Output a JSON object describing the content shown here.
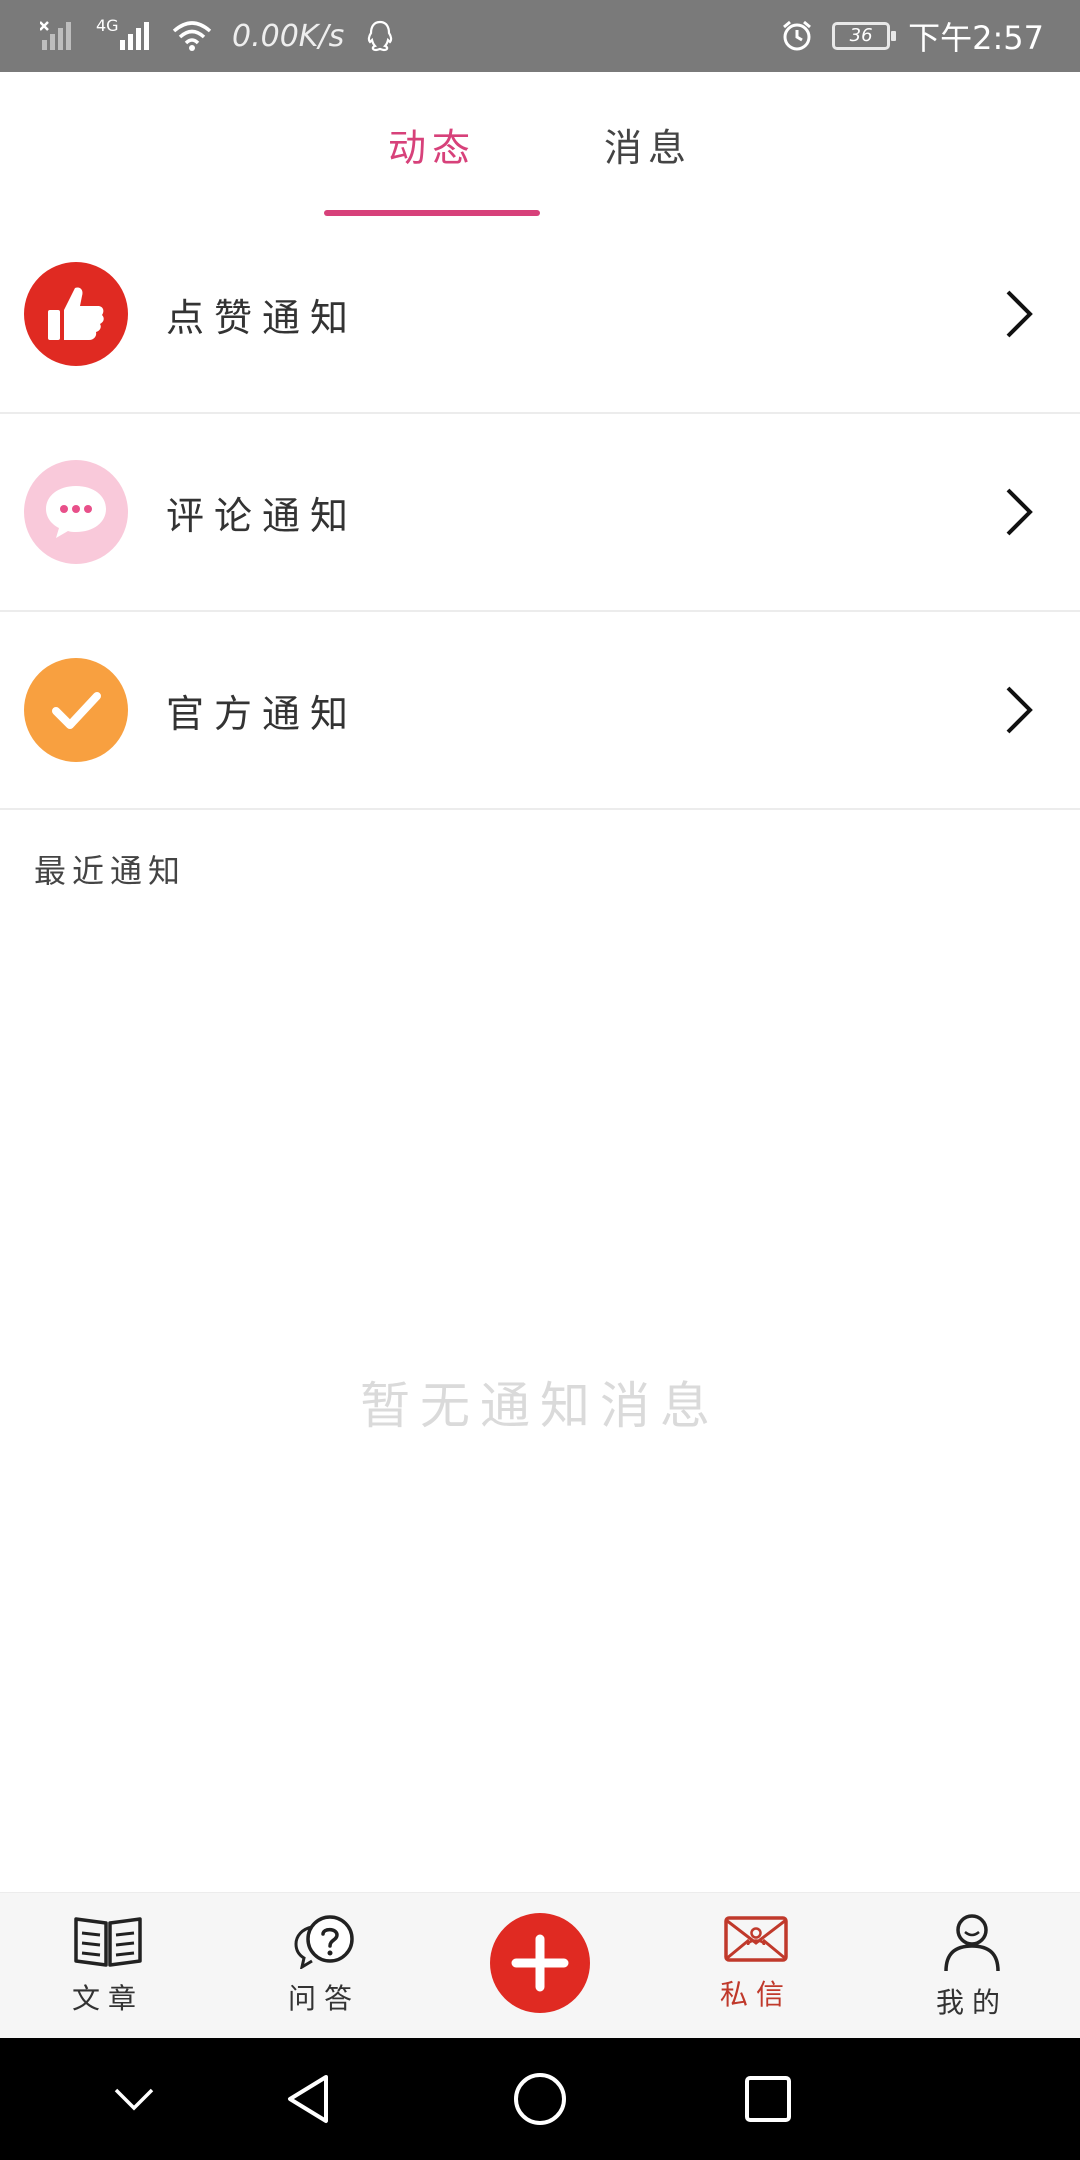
{
  "status_bar": {
    "network_speed": "0.00K/s",
    "network_type": "4G",
    "battery_level": "36",
    "time": "下午2:57",
    "icons": [
      "signal-icon",
      "wifi-icon",
      "qq-icon",
      "alarm-icon",
      "battery-icon"
    ]
  },
  "tabs": [
    {
      "label": "动态",
      "active": true
    },
    {
      "label": "消息",
      "active": false
    }
  ],
  "notifications": [
    {
      "label": "点赞通知",
      "icon": "thumbs-up-icon",
      "color": "#e02a22"
    },
    {
      "label": "评论通知",
      "icon": "comment-icon",
      "color": "#f9c2d6"
    },
    {
      "label": "官方通知",
      "icon": "checkmark-icon",
      "color": "#f8a040"
    }
  ],
  "recent_section": {
    "title": "最近通知"
  },
  "empty_state": {
    "text": "暂无通知消息"
  },
  "bottom_nav": [
    {
      "label": "文章",
      "icon": "book-icon",
      "active": false
    },
    {
      "label": "问答",
      "icon": "question-icon",
      "active": false
    },
    {
      "label": "",
      "icon": "add-icon",
      "active": false
    },
    {
      "label": "私信",
      "icon": "mail-icon",
      "active": true
    },
    {
      "label": "我的",
      "icon": "profile-icon",
      "active": false
    }
  ],
  "colors": {
    "accent": "#d7417a",
    "brand_red": "#e02a22",
    "active_nav": "#c0392b",
    "status_bar": "#7a7a7a"
  }
}
